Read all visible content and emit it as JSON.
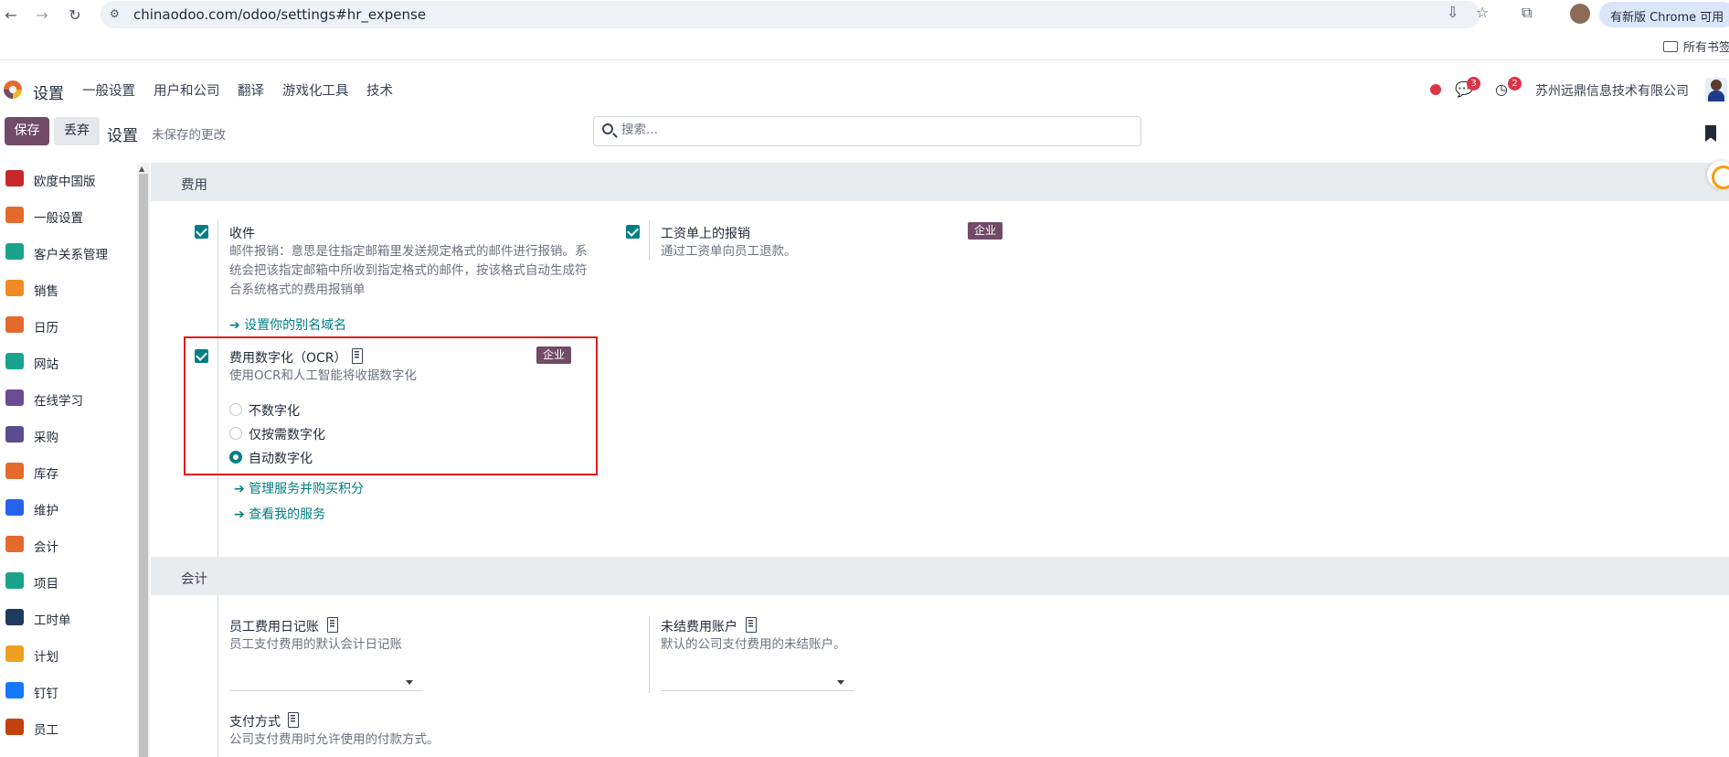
{
  "browser": {
    "url": "chinaodoo.com/odoo/settings#hr_expense",
    "update_label": "有新版 Chrome 可用",
    "bookmarks_all": "所有书签"
  },
  "navbar": {
    "app_title": "设置",
    "menus": [
      "一般设置",
      "用户和公司",
      "翻译",
      "游戏化工具",
      "技术"
    ],
    "messages_count": "3",
    "activities_count": "2",
    "company": "苏州远鼎信息技术有限公司"
  },
  "control_panel": {
    "save_label": "保存",
    "discard_label": "丢弃",
    "title": "设置",
    "unsaved": "未保存的更改",
    "search_placeholder": "搜索..."
  },
  "sidebar": {
    "items": [
      {
        "label": "欧度中国版",
        "icon": "odoo-china-icon",
        "color": "#c62828"
      },
      {
        "label": "一般设置",
        "icon": "odoo-logo-icon",
        "color": "#e46a2c"
      },
      {
        "label": "客户关系管理",
        "icon": "crm-icon",
        "color": "#1aa38c"
      },
      {
        "label": "销售",
        "icon": "sales-icon",
        "color": "#f08a24"
      },
      {
        "label": "日历",
        "icon": "calendar-icon",
        "color": "#e46a2c"
      },
      {
        "label": "网站",
        "icon": "website-icon",
        "color": "#1aa38c"
      },
      {
        "label": "在线学习",
        "icon": "elearning-icon",
        "color": "#6a4c93"
      },
      {
        "label": "采购",
        "icon": "purchase-icon",
        "color": "#5b4c8c"
      },
      {
        "label": "库存",
        "icon": "inventory-icon",
        "color": "#e46a2c"
      },
      {
        "label": "维护",
        "icon": "maintenance-icon",
        "color": "#2563eb"
      },
      {
        "label": "会计",
        "icon": "accounting-icon",
        "color": "#e46a2c"
      },
      {
        "label": "项目",
        "icon": "project-icon",
        "color": "#1aa38c"
      },
      {
        "label": "工时单",
        "icon": "timesheet-icon",
        "color": "#1e3a5f"
      },
      {
        "label": "计划",
        "icon": "planning-icon",
        "color": "#f0a020"
      },
      {
        "label": "钉钉",
        "icon": "dingtalk-icon",
        "color": "#1677ff"
      },
      {
        "label": "员工",
        "icon": "employees-icon",
        "color": "#c2410c"
      }
    ]
  },
  "expenses": {
    "section_title": "费用",
    "receipts": {
      "title": "收件",
      "desc": "邮件报销：意思是往指定邮箱里发送规定格式的邮件进行报销。系统会把该指定邮箱中所收到指定格式的邮件，按该格式自动生成符合系统格式的费用报销单",
      "link": "➔ 设置你的别名域名",
      "checked": true
    },
    "payslip": {
      "title": "工资单上的报销",
      "desc": "通过工资单向员工退款。",
      "badge": "企业",
      "checked": true
    },
    "ocr": {
      "title": "费用数字化（OCR）",
      "desc": "使用OCR和人工智能将收据数字化",
      "badge": "企业",
      "checked": true,
      "options": [
        "不数字化",
        "仅按需数字化",
        "自动数字化"
      ],
      "selected_index": 2,
      "link_manage": "➔ 管理服务并购买积分",
      "link_view": "➔ 查看我的服务"
    }
  },
  "accounting": {
    "section_title": "会计",
    "journal": {
      "title": "员工费用日记账",
      "desc": "员工支付费用的默认会计日记账"
    },
    "outstanding": {
      "title": "未结费用账户",
      "desc": "默认的公司支付费用的未结账户。"
    },
    "payment": {
      "title": "支付方式",
      "desc": "公司支付费用时允许使用的付款方式。"
    }
  }
}
